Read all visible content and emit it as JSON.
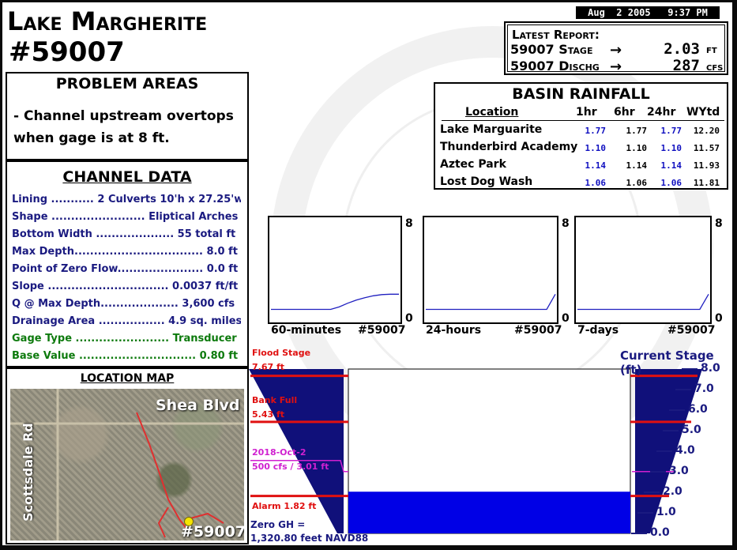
{
  "datetime": "Aug  2 2005   9:37 PM",
  "title": {
    "line1": "Lake Margherite",
    "line2": "#59007"
  },
  "latest_report": {
    "heading": "Latest Report:",
    "stage_label": "59007 Stage",
    "stage_value": "2.03",
    "stage_unit": "FT",
    "dischg_label": "59007 Dischg",
    "dischg_value": "287",
    "dischg_unit": "CFS"
  },
  "problem_areas": {
    "heading": "PROBLEM AREAS",
    "line1": "- Channel upstream overtops",
    "line2": "when gage is at 8 ft."
  },
  "channel_data": {
    "heading": "CHANNEL DATA",
    "rows": [
      {
        "text": "Lining ........... 2 Culverts 10'h x 27.25'w",
        "color": "blue"
      },
      {
        "text": "Shape ........................ Eliptical Arches",
        "color": "blue"
      },
      {
        "text": "Bottom Width .................... 55 total ft",
        "color": "blue"
      },
      {
        "text": "Max Depth................................. 8.0 ft",
        "color": "blue"
      },
      {
        "text": "Point of Zero Flow...................... 0.0 ft",
        "color": "blue"
      },
      {
        "text": "Slope ............................... 0.0037 ft/ft",
        "color": "blue"
      },
      {
        "text": "Q @ Max Depth.................... 3,600 cfs",
        "color": "blue"
      },
      {
        "text": "Drainage Area ................. 4.9 sq. miles",
        "color": "blue"
      },
      {
        "text": "Gage Type ........................ Transducer",
        "color": "green"
      },
      {
        "text": "Base Value .............................. 0.80 ft",
        "color": "green"
      }
    ]
  },
  "location_map": {
    "heading": "LOCATION MAP",
    "road1": "Shea Blvd",
    "road2": "Scottsdale Rd",
    "marker": "#59007"
  },
  "basin_rainfall": {
    "heading": "BASIN RAINFALL",
    "columns": [
      "Location",
      "1hr",
      "6hr",
      "24hr",
      "WYtd"
    ],
    "rows": [
      {
        "name": "Lake Marguarite",
        "h1": "1.77",
        "h6": "1.77",
        "h24": "1.77",
        "wy": "12.20"
      },
      {
        "name": "Thunderbird Academy",
        "h1": "1.10",
        "h6": "1.10",
        "h24": "1.10",
        "wy": "11.57"
      },
      {
        "name": "Aztec Park",
        "h1": "1.14",
        "h6": "1.14",
        "h24": "1.14",
        "wy": "11.93"
      },
      {
        "name": "Lost Dog Wash",
        "h1": "1.06",
        "h6": "1.06",
        "h24": "1.06",
        "wy": "11.81"
      }
    ]
  },
  "mini_charts": [
    {
      "label": "60-minutes",
      "gage": "#59007",
      "ymax": "8",
      "ymin": "0"
    },
    {
      "label": "24-hours",
      "gage": "#59007",
      "ymax": "8",
      "ymin": "0"
    },
    {
      "label": "7-days",
      "gage": "#59007",
      "ymax": "8",
      "ymin": "0"
    }
  ],
  "chart_data": [
    {
      "type": "line",
      "title": "60-minutes",
      "ylim": [
        0,
        8
      ],
      "y": [
        0.8,
        0.8,
        0.8,
        0.8,
        0.8,
        0.8,
        0.8,
        0.8,
        1.0,
        1.3,
        1.55,
        1.75,
        1.9,
        2.0,
        2.03,
        2.03
      ]
    },
    {
      "type": "line",
      "title": "24-hours",
      "ylim": [
        0,
        8
      ],
      "y": [
        0.8,
        0.8,
        0.8,
        0.8,
        0.8,
        0.8,
        0.8,
        0.8,
        0.8,
        0.8,
        0.8,
        0.8,
        0.8,
        0.8,
        0.8,
        2.03
      ]
    },
    {
      "type": "line",
      "title": "7-days",
      "ylim": [
        0,
        8
      ],
      "y": [
        0.8,
        0.8,
        0.8,
        0.8,
        0.8,
        0.8,
        0.8,
        0.8,
        0.8,
        0.8,
        0.8,
        0.8,
        0.8,
        0.8,
        0.8,
        2.03
      ]
    }
  ],
  "stage_gauge": {
    "heading": "Current Stage (ft)",
    "current_stage": 2.03,
    "max": 8.0,
    "ticks": [
      "8.0",
      "7.0",
      "6.0",
      "5.0",
      "4.0",
      "3.0",
      "2.0",
      "1.0",
      "0.0"
    ],
    "flood_stage": {
      "label1": "Flood Stage",
      "label2": "7.67 ft",
      "value": 7.67
    },
    "bank_full": {
      "label1": "Bank Full",
      "label2": "5.43 ft",
      "value": 5.43
    },
    "historic": {
      "label1": "2018-Oct-2",
      "label2": "500 cfs / 3.01 ft",
      "value": 3.01
    },
    "alarm": {
      "label": "Alarm 1.82 ft",
      "value": 1.82
    },
    "zero": {
      "line1": "Zero GH =",
      "line2": "1,320.80 feet NAVD88"
    },
    "colors": {
      "water": "#0000e6",
      "channel": "#10107a",
      "alarm": "#e01010",
      "historic": "#d020d0"
    }
  }
}
